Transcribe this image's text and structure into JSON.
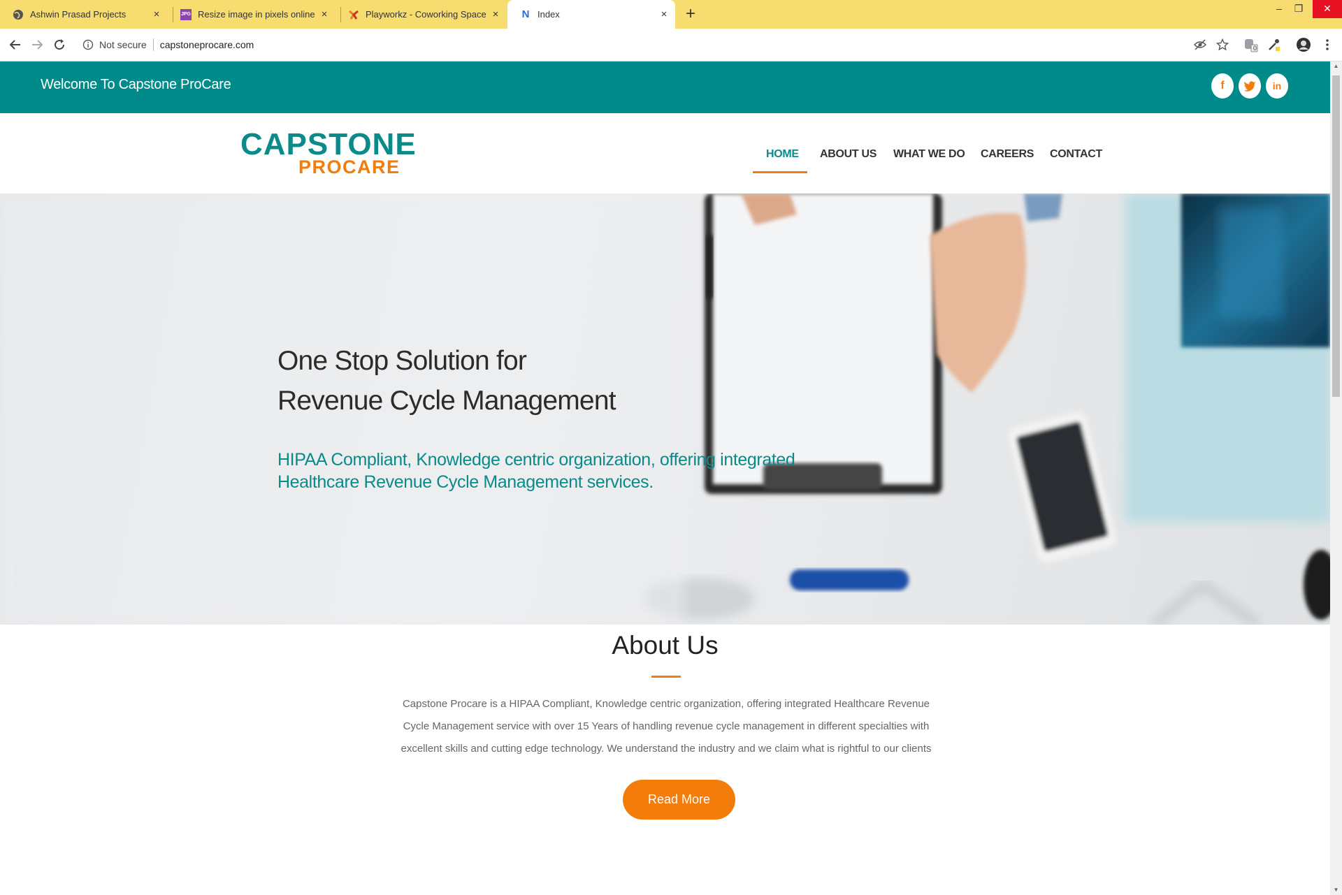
{
  "browser": {
    "tabs": [
      {
        "title": "Ashwin Prasad Projects",
        "favicon": "globe-icon"
      },
      {
        "title": "Resize image in pixels online - IL",
        "favicon": "jpg-icon"
      },
      {
        "title": "Playworkz - Coworking Space",
        "favicon": "playworkz-icon"
      },
      {
        "title": "Index",
        "favicon": "n-icon",
        "active": true
      }
    ],
    "favicon_text": {
      "jpg": "JPG",
      "n": "N"
    },
    "close_glyph": "×",
    "new_tab_glyph": "+",
    "window_controls": {
      "minimize": "–",
      "restore": "❐",
      "close": "✕"
    },
    "security_label": "Not secure",
    "url": "capstoneprocare.com",
    "extension_badge": "0"
  },
  "site": {
    "welcome": "Welcome To Capstone ProCare",
    "social": [
      {
        "name": "facebook",
        "glyph": "f"
      },
      {
        "name": "twitter",
        "glyph": "t"
      },
      {
        "name": "linkedin",
        "glyph": "in"
      }
    ],
    "logo": {
      "line1": "CAPSTONE",
      "line2": "PROCARE"
    },
    "nav": [
      "HOME",
      "ABOUT US",
      "WHAT WE DO",
      "CAREERS",
      "CONTACT"
    ],
    "nav_active": "HOME",
    "hero": {
      "title_line1": "One Stop Solution for",
      "title_line2": "Revenue Cycle Management",
      "subtitle_line1": "HIPAA Compliant, Knowledge centric organization, offering integrated",
      "subtitle_line2": "Healthcare Revenue Cycle Management services."
    },
    "about": {
      "title": "About Us",
      "text": "Capstone Procare is a HIPAA Compliant, Knowledge centric organization, offering integrated Healthcare Revenue Cycle Management service with over 15 Years of handling revenue cycle management in different specialties with excellent skills and cutting edge technology. We understand the industry and we claim what is rightful to our clients",
      "button": "Read More"
    }
  },
  "colors": {
    "teal": "#008b8b",
    "orange": "#f47c0a",
    "tabbar": "#f7dc6f"
  }
}
